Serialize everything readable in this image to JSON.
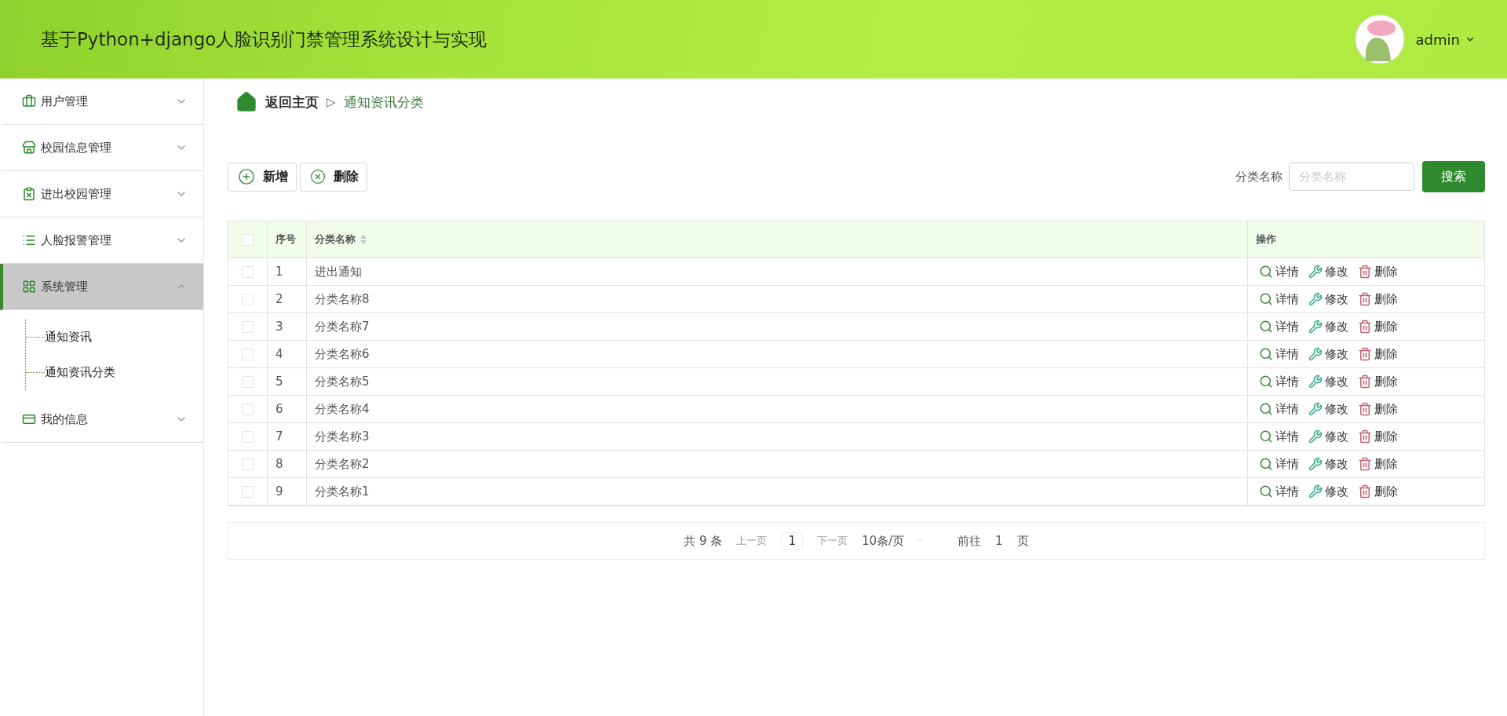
{
  "header": {
    "title": "基于Python+django人脸识别门禁管理系统设计与实现",
    "user": "admin"
  },
  "sidebar": {
    "items": [
      {
        "kind": "briefcase",
        "label": "用户管理",
        "selected": false,
        "expanded": false
      },
      {
        "kind": "store",
        "label": "校园信息管理",
        "selected": false,
        "expanded": false
      },
      {
        "kind": "clipboard",
        "label": "进出校园管理",
        "selected": false,
        "expanded": false
      },
      {
        "kind": "list",
        "label": "人脸报警管理",
        "selected": false,
        "expanded": false
      },
      {
        "kind": "grid",
        "label": "系统管理",
        "selected": true,
        "expanded": true,
        "children": [
          {
            "label": "通知资讯"
          },
          {
            "label": "通知资讯分类"
          }
        ]
      },
      {
        "kind": "card",
        "label": "我的信息",
        "selected": false,
        "expanded": false
      }
    ]
  },
  "breadcrumb": {
    "home": "返回主页",
    "separator": "▷",
    "current": "通知资讯分类"
  },
  "toolbar": {
    "add": "新增",
    "delete": "删除",
    "search_label": "分类名称",
    "search_placeholder": "分类名称",
    "search_button": "搜索"
  },
  "table": {
    "header_checked": false,
    "columns": [
      "序号",
      "分类名称",
      "操作"
    ],
    "rows": [
      {
        "index": "1",
        "name": "进出通知",
        "checked": false,
        "actions": [
          "详情",
          "修改",
          "删除"
        ]
      },
      {
        "index": "2",
        "name": "分类名称8",
        "checked": false,
        "actions": [
          "详情",
          "修改",
          "删除"
        ]
      },
      {
        "index": "3",
        "name": "分类名称7",
        "checked": false,
        "actions": [
          "详情",
          "修改",
          "删除"
        ]
      },
      {
        "index": "4",
        "name": "分类名称6",
        "checked": false,
        "actions": [
          "详情",
          "修改",
          "删除"
        ]
      },
      {
        "index": "5",
        "name": "分类名称5",
        "checked": false,
        "actions": [
          "详情",
          "修改",
          "删除"
        ]
      },
      {
        "index": "6",
        "name": "分类名称4",
        "checked": false,
        "actions": [
          "详情",
          "修改",
          "删除"
        ]
      },
      {
        "index": "7",
        "name": "分类名称3",
        "checked": false,
        "actions": [
          "详情",
          "修改",
          "删除"
        ]
      },
      {
        "index": "8",
        "name": "分类名称2",
        "checked": false,
        "actions": [
          "详情",
          "修改",
          "删除"
        ]
      },
      {
        "index": "9",
        "name": "分类名称1",
        "checked": false,
        "actions": [
          "详情",
          "修改",
          "删除"
        ]
      }
    ]
  },
  "pagination": {
    "total": "共 9 条",
    "prev": "上一页",
    "page": "1",
    "next": "下一页",
    "page_size": "10条/页",
    "goto": "前往",
    "goto_value": "1",
    "goto_suffix": "页"
  }
}
